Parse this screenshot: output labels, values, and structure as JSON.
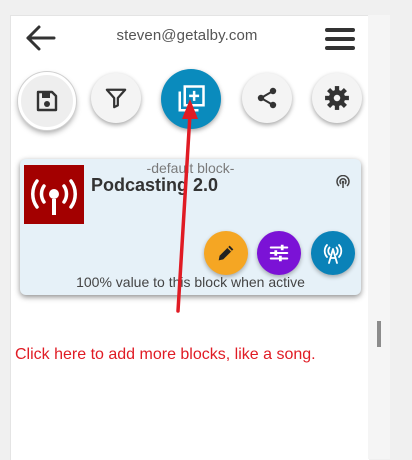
{
  "header": {
    "account_email": "steven@getalby.com",
    "back_icon": "arrow-left-icon",
    "menu_icon": "hamburger-menu-icon"
  },
  "toolbar": {
    "buttons": [
      {
        "name": "save",
        "icon": "floppy-disk-icon"
      },
      {
        "name": "filter",
        "icon": "funnel-icon"
      },
      {
        "name": "add-block",
        "icon": "add-to-library-icon"
      },
      {
        "name": "share",
        "icon": "share-nodes-icon"
      },
      {
        "name": "settings",
        "icon": "gear-icon"
      }
    ]
  },
  "block": {
    "default_label": "-default block-",
    "title": "Podcasting 2.0",
    "value_note": "100% value to this block when active",
    "thumbnail_icon": "podcast-broadcast-icon",
    "feed_icon": "podcast-feed-icon",
    "actions": [
      {
        "name": "edit",
        "icon": "pencil-icon",
        "color": "#f5a623"
      },
      {
        "name": "tune",
        "icon": "sliders-icon",
        "color": "#7b12d6"
      },
      {
        "name": "broadcast",
        "icon": "radio-tower-icon",
        "color": "#0a82b8"
      }
    ]
  },
  "annotation": {
    "hint_text": "Click here to add more blocks, like a song.",
    "color": "#e01b24"
  },
  "colors": {
    "primary": "#0a8bbd",
    "thumbnail_bg": "#a30000",
    "card_bg": "#e6f1f8"
  }
}
